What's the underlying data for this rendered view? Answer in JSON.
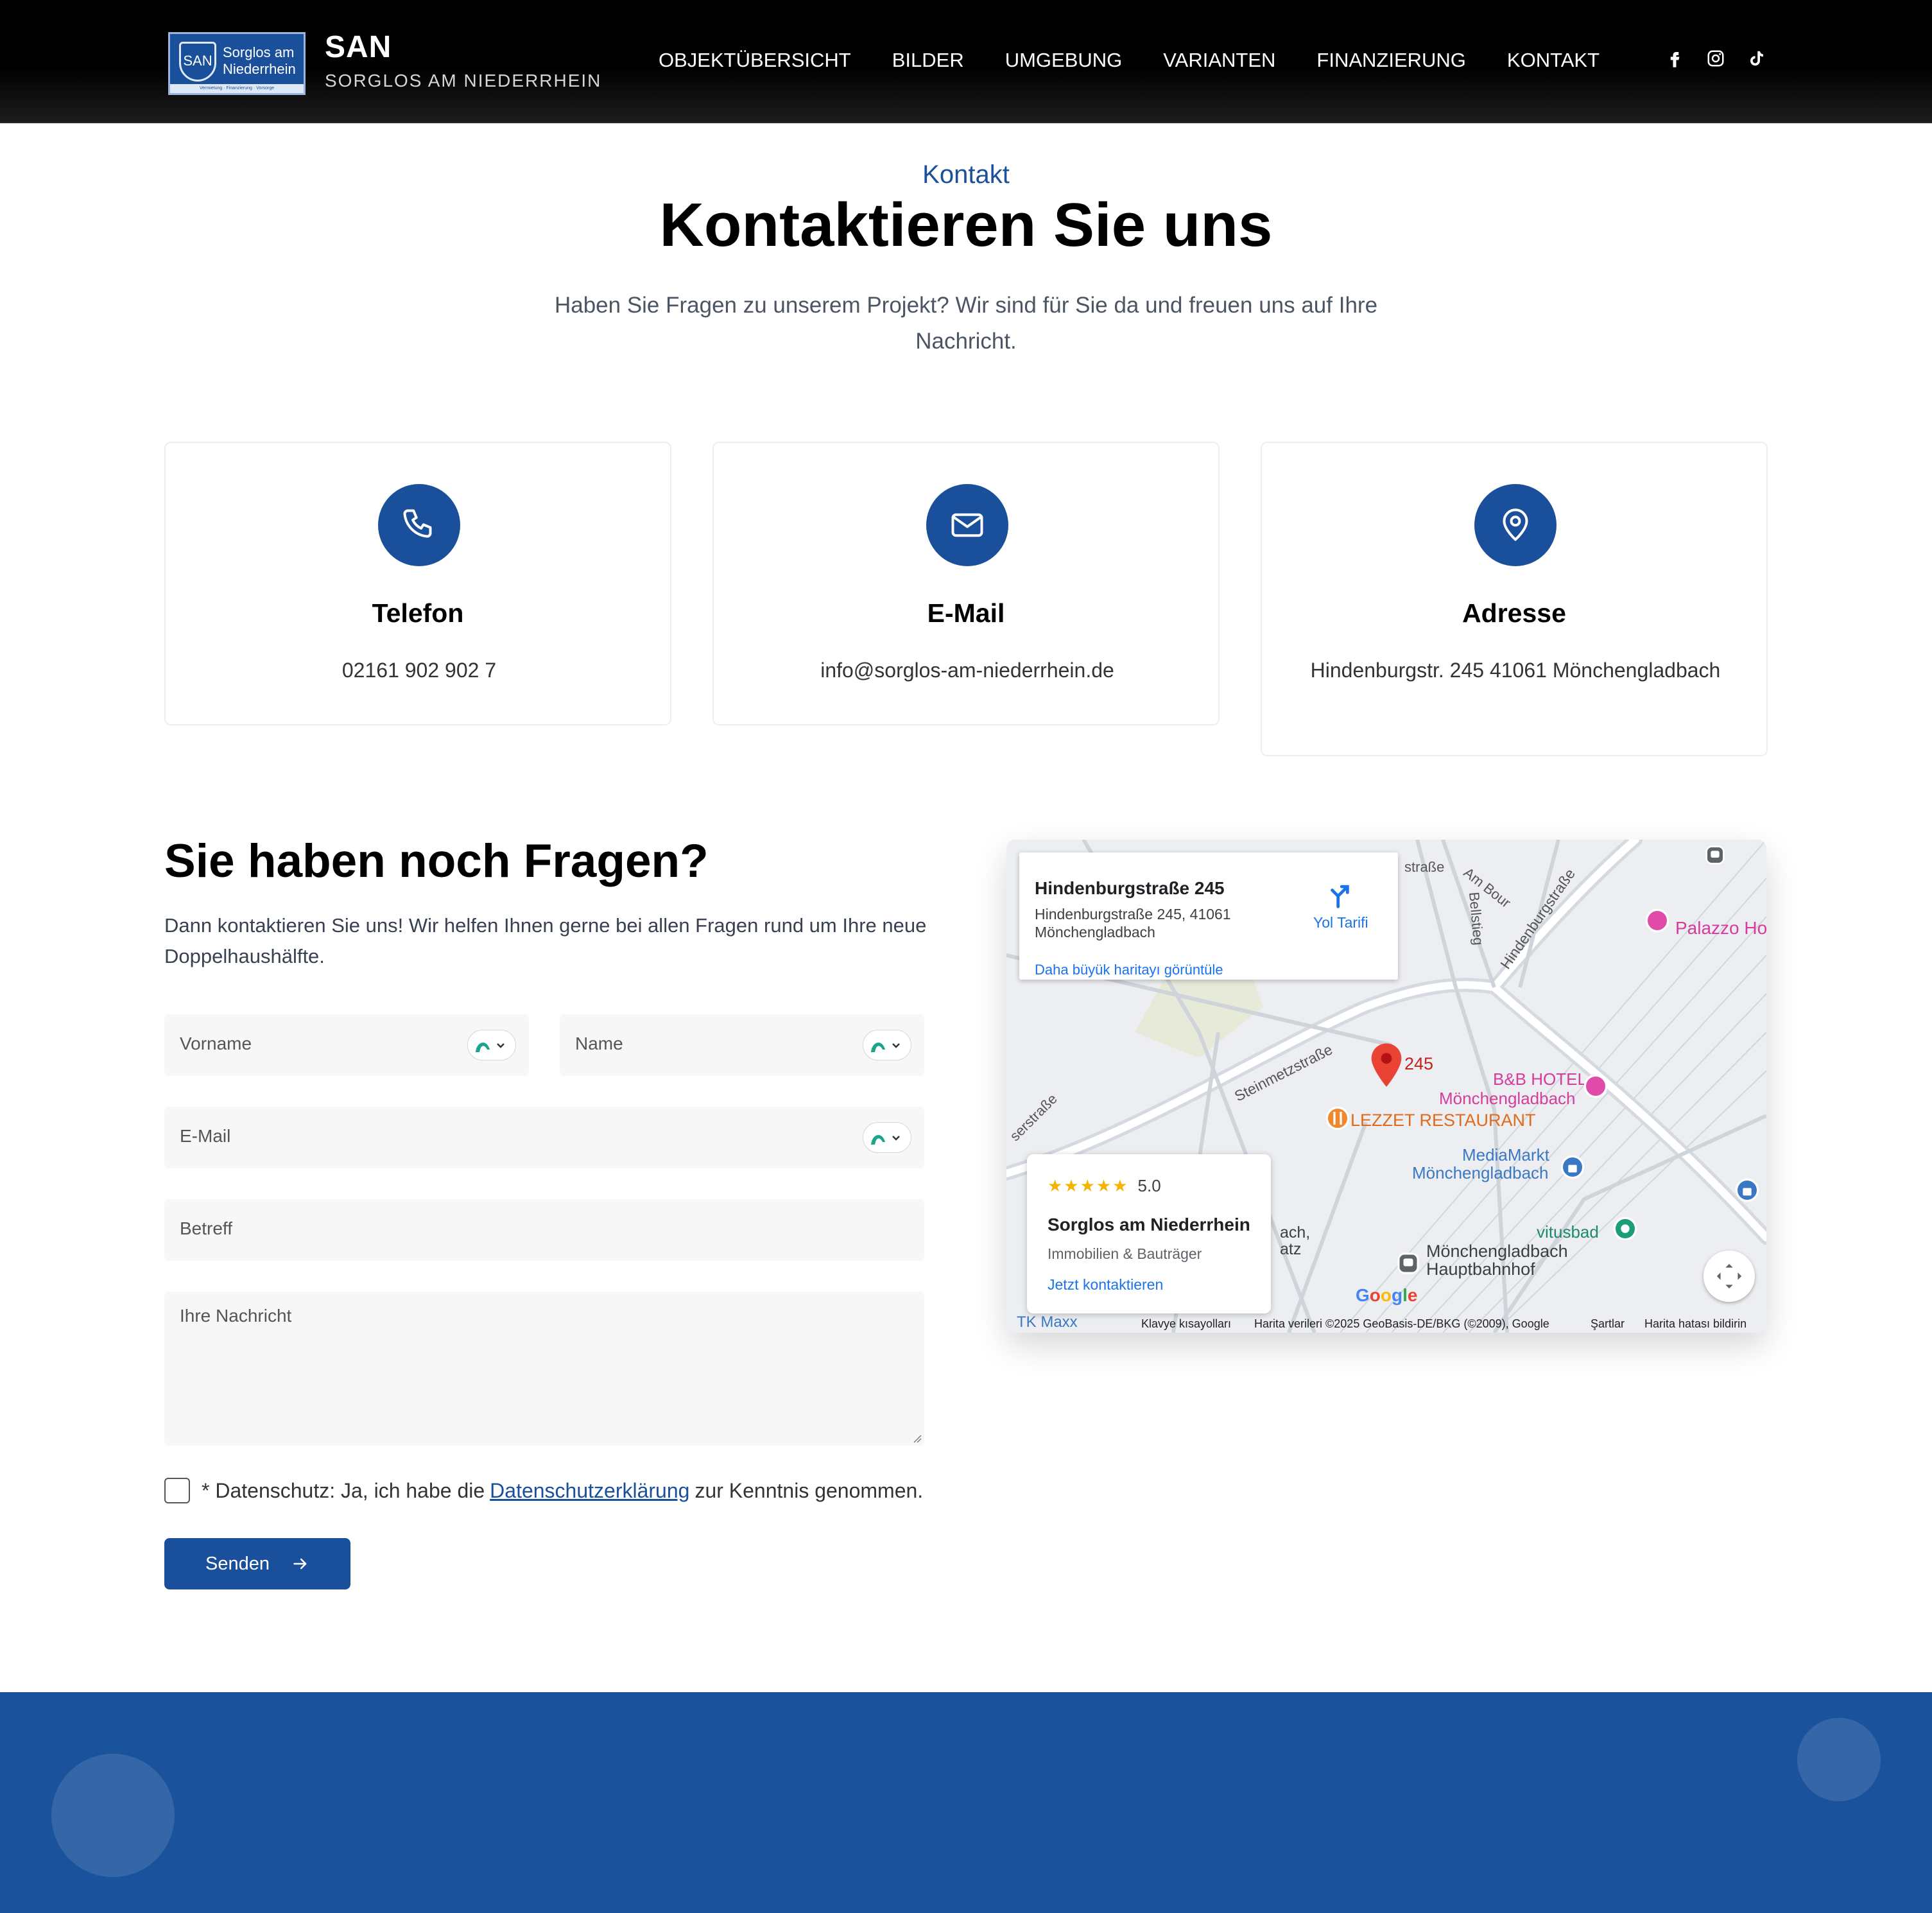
{
  "header": {
    "logo_badge_abbr": "SAN",
    "logo_badge_line1": "Sorglos am",
    "logo_badge_line2": "Niederrhein",
    "logo_badge_strip": "Vermietung · Finanzierung · Vorsorge",
    "brand_title": "SAN",
    "brand_subtitle": "SORGLOS AM NIEDERRHEIN",
    "nav": [
      "OBJEKTÜBERSICHT",
      "BILDER",
      "UMGEBUNG",
      "VARIANTEN",
      "FINANZIERUNG",
      "KONTAKT"
    ],
    "social_icons": [
      "facebook-icon",
      "instagram-icon",
      "tiktok-icon"
    ]
  },
  "intro": {
    "eyebrow": "Kontakt",
    "title": "Kontaktieren Sie uns",
    "text": "Haben Sie Fragen zu unserem Projekt? Wir sind für Sie da und freuen uns auf Ihre Nachricht."
  },
  "cards": [
    {
      "icon": "phone-icon",
      "title": "Telefon",
      "value": "02161 902 902 7"
    },
    {
      "icon": "mail-icon",
      "title": "E-Mail",
      "value": "info@sorglos-am-niederrhein.de"
    },
    {
      "icon": "location-pin-icon",
      "title": "Adresse",
      "value": "Hindenburgstr. 245 41061 Mönchengladbach"
    }
  ],
  "form": {
    "heading": "Sie haben noch Fragen?",
    "intro": "Dann kontaktieren Sie uns! Wir helfen Ihnen gerne bei allen Fragen rund um Ihre neue Doppelhaushälfte.",
    "firstname_placeholder": "Vorname",
    "lastname_placeholder": "Name",
    "email_placeholder": "E-Mail",
    "subject_placeholder": "Betreff",
    "message_placeholder": "Ihre Nachricht",
    "consent_prefix": "* Datenschutz: Ja, ich habe die",
    "consent_link": "Datenschutzerklärung",
    "consent_suffix": "zur Kenntnis genommen.",
    "consent_checked": false,
    "submit_label": "Senden"
  },
  "map": {
    "info_title": "Hindenburgstraße 245",
    "info_address_line1": "Hindenburgstraße 245, 41061",
    "info_address_line2": "Mönchengladbach",
    "directions_label": "Yol Tarifi",
    "larger_map_link": "Daha büyük haritayı görüntüle",
    "pin_label": "245",
    "business_rating": "5.0",
    "business_stars": "★★★★★",
    "business_name": "Sorglos am Niederrhein",
    "business_category": "Immobilien & Bauträger",
    "business_link": "Jetzt kontaktieren",
    "labels": {
      "palazzo": "Palazzo Hotel",
      "bb_hotel_1": "B&B HOTEL",
      "bb_hotel_2": "Mönchengladbach",
      "lezzet": "LEZZET RESTAURANT",
      "mediamarkt_1": "MediaMarkt",
      "mediamarkt_2": "Mönchengladbach",
      "vitusbad": "vitusbad",
      "hbf_1": "Mönchengladbach",
      "hbf_2": "Hauptbahnhof",
      "steinmetz": "Steinmetzstraße",
      "hindenburg": "Hindenburgstraße",
      "bellstieg": "Bellstieg",
      "am_bour": "Am Bour",
      "strasse_top": "straße",
      "kaiser": "serstraße",
      "tk_maxx": "TK Maxx",
      "ach": "ach,",
      "atz": "atz"
    },
    "google_logo": "Google",
    "footer_shortcuts": "Klavye kısayolları",
    "footer_data": "Harita verileri ©2025 GeoBasis-DE/BKG (©2009), Google",
    "footer_terms": "Şartlar",
    "footer_report": "Harita hatası bildirin"
  },
  "colors": {
    "brand_blue": "#1a4f9c",
    "header_bg": "#000000",
    "footer_blue": "#1a529c",
    "map_link": "#1a73e8"
  }
}
